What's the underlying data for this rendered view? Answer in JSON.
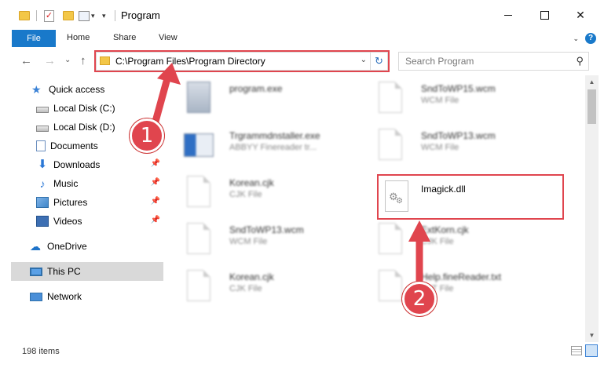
{
  "window": {
    "title": "Program",
    "controls": {
      "minimize": "",
      "maximize": "",
      "close": "✕"
    }
  },
  "quick_access_toolbar": {
    "check_glyph": "✓",
    "dropdown_glyph": "▾"
  },
  "ribbon": {
    "tabs": [
      "File",
      "Home",
      "Share",
      "View"
    ],
    "collapse_glyph": "⌄",
    "help_glyph": "?"
  },
  "nav": {
    "back_glyph": "←",
    "forward_glyph": "→",
    "recent_glyph": "⌄",
    "up_glyph": "↑",
    "address": "C:\\Program Files\\Program Directory",
    "address_dropdown_glyph": "⌄",
    "refresh_glyph": "↻",
    "search_placeholder": "Search Program",
    "search_glyph": "⚲"
  },
  "sidebar": {
    "pin_glyph": "📌",
    "items": [
      {
        "label": "Quick access",
        "icon": "star-icon",
        "pinned": false
      },
      {
        "label": "Local Disk (C:)",
        "icon": "disk-icon",
        "pinned": false
      },
      {
        "label": "Local Disk (D:)",
        "icon": "disk-icon",
        "pinned": false
      },
      {
        "label": "Documents",
        "icon": "document-icon",
        "pinned": false
      },
      {
        "label": "Downloads",
        "icon": "download-icon",
        "pinned": true
      },
      {
        "label": "Music",
        "icon": "music-icon",
        "pinned": true
      },
      {
        "label": "Pictures",
        "icon": "pictures-icon",
        "pinned": true
      },
      {
        "label": "Videos",
        "icon": "videos-icon",
        "pinned": true
      },
      {
        "label": "OneDrive",
        "icon": "cloud-icon",
        "pinned": false
      },
      {
        "label": "This PC",
        "icon": "computer-icon",
        "pinned": false,
        "selected": true
      },
      {
        "label": "Network",
        "icon": "network-icon",
        "pinned": false
      }
    ]
  },
  "files": [
    {
      "name": "program.exe",
      "type": ""
    },
    {
      "name": "SndToWP15.wcm",
      "type": "WCM File"
    },
    {
      "name": "Trgrammdnstaller.exe",
      "type": "ABBYY Finereader tr..."
    },
    {
      "name": "SndToWP13.wcm",
      "type": "WCM File"
    },
    {
      "name": "Korean.cjk",
      "type": "CJK File"
    },
    {
      "name": "Imagick.dll",
      "type": "",
      "highlighted": true
    },
    {
      "name": "SndToWP13.wcm",
      "type": "WCM File"
    },
    {
      "name": "ExtKorn.cjk",
      "type": "CJK File"
    },
    {
      "name": "Korean.cjk",
      "type": "CJK File"
    },
    {
      "name": "Help.fineReader.txt",
      "type": "TXT File"
    }
  ],
  "status": {
    "item_count": "198 items"
  },
  "scrollbar": {
    "up_glyph": "▲",
    "down_glyph": "▼"
  },
  "annotations": {
    "step1": "1",
    "step2": "2",
    "color": "#e0454e"
  }
}
